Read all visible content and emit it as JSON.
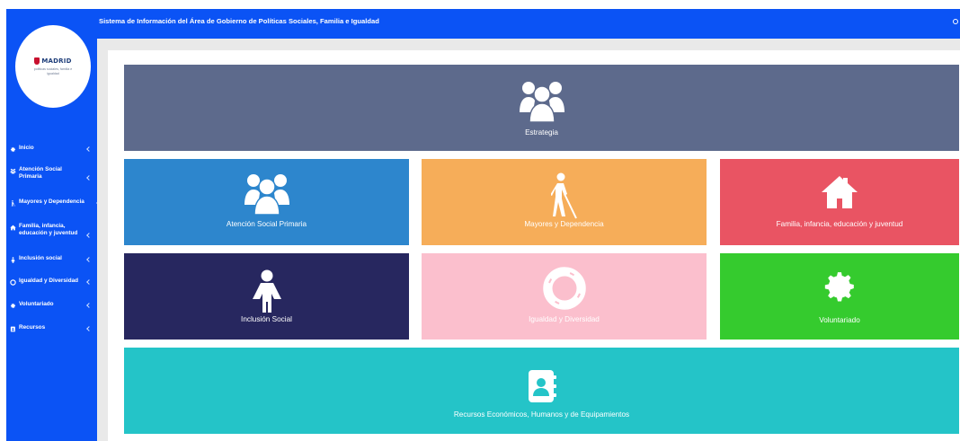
{
  "header": {
    "title": "Sistema de Información del Área de Gobierno de Políticas Sociales, Familia e Igualdad"
  },
  "logo": {
    "title": "MADRID",
    "subtitle": "políticas sociales, familia e igualdad"
  },
  "sidebar": {
    "items": [
      {
        "label": "Inicio",
        "icon": "gear-icon"
      },
      {
        "label": "Atención Social Primaria",
        "icon": "users-icon"
      },
      {
        "label": "Mayores y Dependencia",
        "icon": "blind-person-icon"
      },
      {
        "label": "Familia, infancia, educación y juventud",
        "icon": "home-icon"
      },
      {
        "label": "Inclusión social",
        "icon": "person-icon"
      },
      {
        "label": "Igualdad y Diversidad",
        "icon": "lifebuoy-icon"
      },
      {
        "label": "Voluntariado",
        "icon": "gear-icon"
      },
      {
        "label": "Recursos",
        "icon": "contact-book-icon"
      }
    ]
  },
  "tiles": {
    "estrategia": {
      "label": "Estrategia",
      "icon": "users-icon",
      "color": "#5d6a8c"
    },
    "atencion": {
      "label": "Atención Social Primaria",
      "icon": "users-icon",
      "color": "#2d86cd"
    },
    "mayores": {
      "label": "Mayores y Dependencia",
      "icon": "blind-person-icon",
      "color": "#f6ad59"
    },
    "familia": {
      "label": "Familia, infancia, educación y juventud",
      "icon": "home-icon",
      "color": "#e95463"
    },
    "inclusion": {
      "label": "Inclusión Social",
      "icon": "person-icon",
      "color": "#27275f"
    },
    "igualdad": {
      "label": "Igualdad y Diversidad",
      "icon": "lifebuoy-icon",
      "color": "#fbbfcd"
    },
    "voluntariado": {
      "label": "Voluntariado",
      "icon": "gear-icon",
      "color": "#35cb2e"
    },
    "recursos": {
      "label": "Recursos Económicos, Humanos y de Equipamientos",
      "icon": "contact-book-icon",
      "color": "#24c4c8"
    }
  },
  "colors": {
    "brand_blue": "#0b53f5",
    "content_bg": "#e9e9e9"
  }
}
